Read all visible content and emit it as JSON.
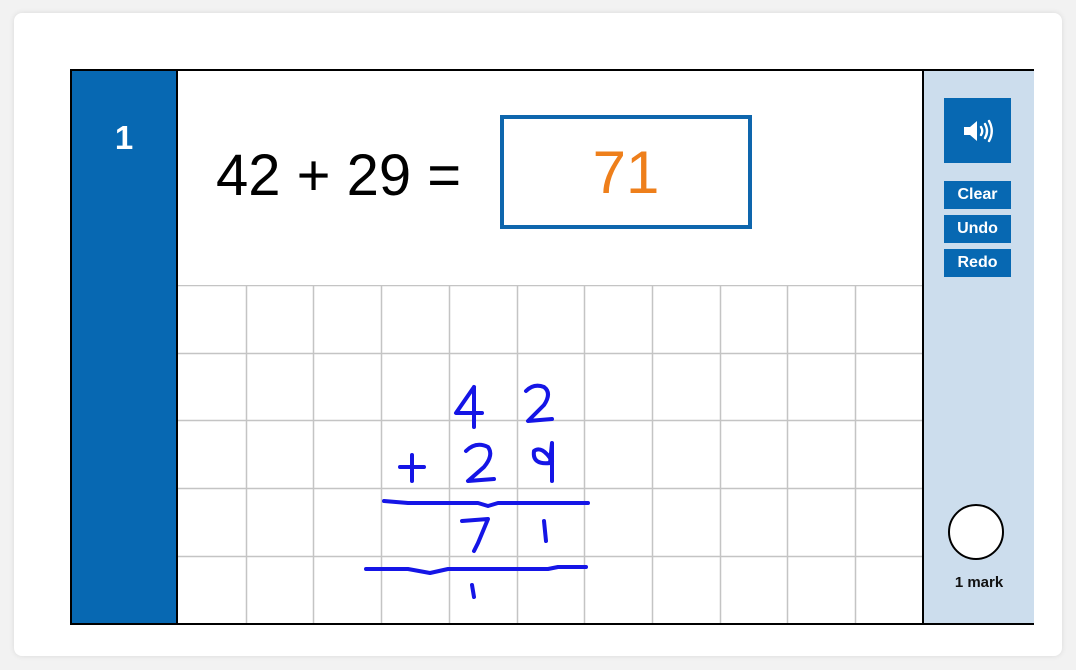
{
  "question": {
    "number": "1",
    "expression": "42 + 29 =",
    "answer_value": "71",
    "answer_color": "#ee7f1b"
  },
  "colors": {
    "primary_blue": "#0768b2",
    "sidebar_bg": "#ccdded",
    "ink_blue": "#1515e6",
    "grid_line": "#c4c4c4"
  },
  "workings": {
    "digits": [
      {
        "char": "4",
        "col": 4,
        "row": 1
      },
      {
        "char": "2",
        "col": 5,
        "row": 1
      },
      {
        "char": "+",
        "col": 3,
        "row": 2
      },
      {
        "char": "2",
        "col": 4,
        "row": 2
      },
      {
        "char": "9",
        "col": 5,
        "row": 2
      },
      {
        "char": "7",
        "col": 4,
        "row": 3
      },
      {
        "char": "1",
        "col": 5,
        "row": 3
      },
      {
        "char": "1",
        "col": 4,
        "row": 4
      }
    ]
  },
  "sidebar": {
    "audio_icon": "speaker-icon",
    "buttons": [
      {
        "label": "Clear"
      },
      {
        "label": "Undo"
      },
      {
        "label": "Redo"
      }
    ],
    "marks_label": "1 mark"
  }
}
